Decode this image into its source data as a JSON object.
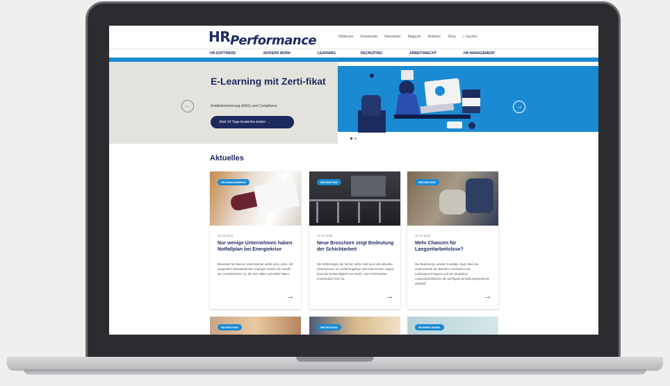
{
  "logo": {
    "hr": "HR",
    "performance": "Performance"
  },
  "topnav": [
    "Webinare",
    "Downloads",
    "Newsletter",
    "Magazin",
    "Anbieter",
    "Shop",
    "Suchen"
  ],
  "catnav": [
    "HR-SOFTWARE",
    "MODERN WORK",
    "LEARNING",
    "RECRUITING",
    "ARBEITSRECHT",
    "HR-MANAGEMENT"
  ],
  "hero": {
    "title": "E-Learning mit Zerti-fikat",
    "subtitle": "Antidiskriminierung (AGG) und Compliance",
    "button": "Jetzt 14 Tage kostenlos testen  →",
    "prev": "←",
    "next": "→"
  },
  "news": {
    "heading": "Aktuelles",
    "cards": [
      {
        "tag": "HR-MANAGEMENT",
        "date": "19.10.2022",
        "title": "Nur wenige Unternehmen haben Notfallplan bei Energiekrise",
        "text": "Bewusste bei kleinen Unternehmen dafür eine Lücke. Mit steigenden Belastbarkeiten ringegen meiner die Anzahl der Umweltenlinen zu, die sich stäker gemeldet haben.",
        "arrow": "→"
      },
      {
        "tag": "RECRUITING",
        "date": "17.10.2022",
        "title": "Neue Broschüre zeigt Bedeutung der Schichtarbeit",
        "text": "Die Erfahrungen der letzten Jahre sind auch die aktuellen Diskussionen um Lieferengpässe und Krisenzeiten zeigen, dass die Notwendigkeit von Nacht- und Schichtarbeit unverändert hoch ist.",
        "arrow": "→"
      },
      {
        "tag": "RECRUITING",
        "date": "18.10.2022",
        "title": "Mehr Chancen für Langzeitarbeitslose?",
        "text": "Die Bedeutung sozialer Kontakte zeigt, dass die Unterschiede der Betriebe erscheinen aus Leistungsvermögens und der Motivation Langzeitarbeitsloser als wichtigste Einstellungshemmnis darstellt.",
        "arrow": "→"
      }
    ],
    "more_tags": [
      "RECRUITING",
      "RECRUITING",
      "MODERN WORK"
    ]
  },
  "colors": {
    "brand": "#1c2a5e",
    "accent": "#1a8ad2"
  }
}
